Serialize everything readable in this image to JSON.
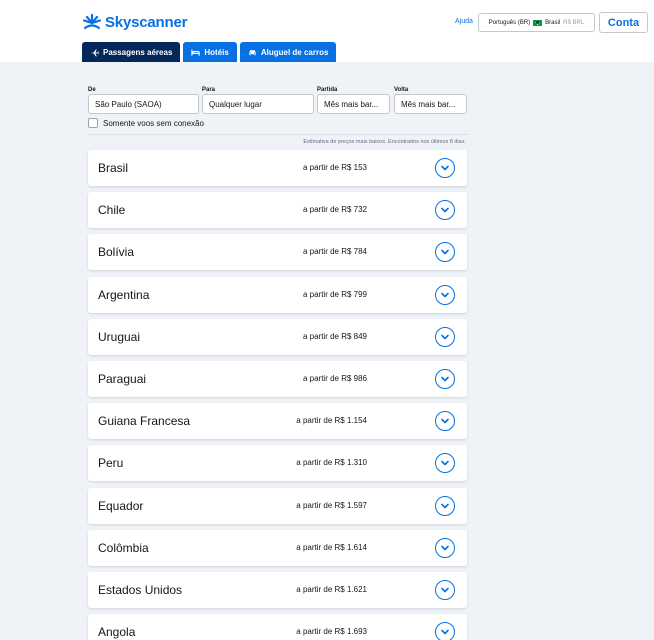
{
  "brand": {
    "name": "Skyscanner",
    "color": "#0770e3"
  },
  "header": {
    "help": "Ajuda",
    "locale": {
      "language": "Português (BR)",
      "country": "Brasil",
      "currency": "R$ BRL",
      "flag_icon": "brazil-flag-icon"
    },
    "account": "Conta"
  },
  "tabs": [
    {
      "label": "Passagens aéreas",
      "icon": "plane-icon",
      "active": true
    },
    {
      "label": "Hotéis",
      "icon": "bed-icon",
      "active": false
    },
    {
      "label": "Aluguel de carros",
      "icon": "car-icon",
      "active": false
    }
  ],
  "search": {
    "from": {
      "label": "De",
      "value": "São Paulo (SAOA)"
    },
    "to": {
      "label": "Para",
      "value": "Qualquer lugar"
    },
    "depart": {
      "label": "Partida",
      "value": "Mês mais bar..."
    },
    "return": {
      "label": "Volta",
      "value": "Mês mais bar..."
    },
    "direct_only": {
      "label": "Somente voos sem conexão",
      "checked": false
    }
  },
  "estimate_note": "Estimativa de preços mais baixos. Encontrados nos últimos 8 dias.",
  "results": [
    {
      "country": "Brasil",
      "price": "a partir de R$ 153"
    },
    {
      "country": "Chile",
      "price": "a partir de R$ 732"
    },
    {
      "country": "Bolívia",
      "price": "a partir de R$ 784"
    },
    {
      "country": "Argentina",
      "price": "a partir de R$ 799"
    },
    {
      "country": "Uruguai",
      "price": "a partir de R$ 849"
    },
    {
      "country": "Paraguai",
      "price": "a partir de R$ 986"
    },
    {
      "country": "Guiana Francesa",
      "price": "a partir de R$ 1.154"
    },
    {
      "country": "Peru",
      "price": "a partir de R$ 1.310"
    },
    {
      "country": "Equador",
      "price": "a partir de R$ 1.597"
    },
    {
      "country": "Colômbia",
      "price": "a partir de R$ 1.614"
    },
    {
      "country": "Estados Unidos",
      "price": "a partir de R$ 1.621"
    },
    {
      "country": "Angola",
      "price": "a partir de R$ 1.693"
    }
  ]
}
